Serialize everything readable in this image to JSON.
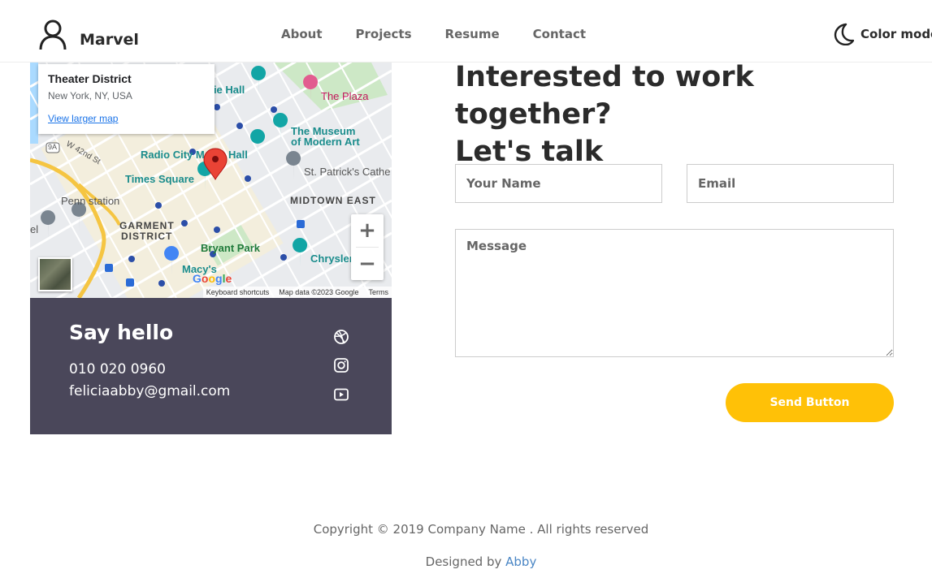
{
  "header": {
    "brand": "Marvel",
    "brand_icon": "user-icon",
    "nav": [
      "About",
      "Projects",
      "Resume",
      "Contact"
    ],
    "color_mode_label": "Color mode",
    "color_mode_icon": "moon-icon"
  },
  "map": {
    "info_title": "Theater District",
    "info_subtitle": "New York, NY, USA",
    "info_link": "View larger map",
    "labels": {
      "carnegie_hall": "gie Hall",
      "the_plaza": "The Plaza",
      "museum_line1": "The Museum",
      "museum_line2": "of Modern Art",
      "radio_city": "Radio City M",
      "radio_city_end": "Hall",
      "w42": "W 42nd St",
      "route_9a": "9A",
      "times_square": "Times Square",
      "st_patricks": "St. Patrick's Cathe",
      "midtown_east": "MIDTOWN EAST",
      "penn_station": "Penn station",
      "garment_line1": "GARMENT",
      "garment_line2": "DISTRICT",
      "bryant_park": "Bryant Park",
      "chrysler": "Chrysler",
      "macys": "Macy's",
      "el_fragment": "el"
    },
    "google_logo": "Google",
    "footer": {
      "shortcuts": "Keyboard shortcuts",
      "data": "Map data ©2023 Google",
      "terms": "Terms"
    },
    "zoom_in": "+",
    "zoom_out": "−"
  },
  "contact": {
    "heading": "Say hello",
    "phone": "010 020 0960",
    "email": "feliciaabby@gmail.com",
    "social_icons": [
      "dribbble-icon",
      "instagram-icon",
      "youtube-icon"
    ]
  },
  "form": {
    "title_line1": "Interested to work together?",
    "title_line2": "Let's talk",
    "name_placeholder": "Your Name",
    "email_placeholder": "Email",
    "message_placeholder": "Message",
    "submit_label": "Send Button"
  },
  "footer": {
    "copyright": "Copyright © 2019 Company Name . All rights reserved",
    "designed_prefix": "Designed by ",
    "designed_name": "Abby"
  },
  "colors": {
    "accent": "#ffc107",
    "card_bg": "#4a475a",
    "link": "#4a86c5"
  }
}
